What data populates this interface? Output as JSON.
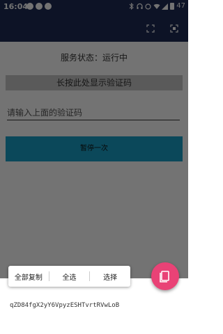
{
  "status_bar": {
    "time": "16:04",
    "battery": "47"
  },
  "content": {
    "service_status": "服务状态：运行中",
    "code_display": "长按此处显示验证码",
    "code_input_placeholder": "请输入上面的验证码",
    "pause_button": "暂停一次"
  },
  "context_menu": {
    "copy_all": "全部复制",
    "select_all": "全选",
    "select": "选择"
  },
  "selected_text": "qZD84fgX2yY6VpyzESHTvrtRVwLoB",
  "colors": {
    "toolbar": "#1d2a56",
    "pause_button": "#1aa0c8",
    "fab": "#e94276"
  }
}
